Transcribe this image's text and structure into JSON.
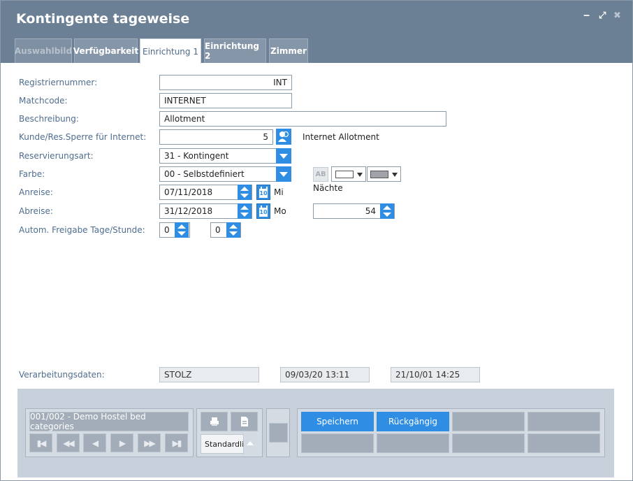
{
  "window": {
    "title": "Kontingente tageweise",
    "controls": {
      "minimize": "‒",
      "restore": "⤢",
      "close": "✖"
    }
  },
  "tabs": [
    {
      "label": "Auswahlbild",
      "state": "disabled"
    },
    {
      "label": "Verfügbarkeit",
      "state": "normal"
    },
    {
      "label": "Einrichtung 1",
      "state": "active"
    },
    {
      "label": "Einrichtung 2",
      "state": "normal"
    },
    {
      "label": "Zimmer",
      "state": "normal"
    }
  ],
  "form": {
    "registriernummer": {
      "label": "Registriernummer:",
      "value": "INT"
    },
    "matchcode": {
      "label": "Matchcode:",
      "value": "INTERNET"
    },
    "beschreibung": {
      "label": "Beschreibung:",
      "value": "Allotment"
    },
    "kunde": {
      "label": "Kunde/Res.Sperre für Internet:",
      "value": "5",
      "name": "Internet Allotment"
    },
    "reservierungsart": {
      "label": "Reservierungsart:",
      "value": "31 - Kontingent"
    },
    "farbe": {
      "label": "Farbe:",
      "value": "00 - Selbstdefiniert",
      "ab_label": "AB",
      "naechte_label": "Nächte"
    },
    "anreise": {
      "label": "Anreise:",
      "value": "07/11/2018",
      "weekday": "Mi"
    },
    "abreise": {
      "label": "Abreise:",
      "value": "31/12/2018",
      "weekday": "Mo",
      "naechte": "54"
    },
    "freigabe": {
      "label": "Autom. Freigabe Tage/Stunde:",
      "tage": "0",
      "stunde": "0"
    },
    "cal_day": "10"
  },
  "processing": {
    "label": "Verarbeitungsdaten:",
    "user": "STOLZ",
    "date1": "09/03/20 13:11",
    "date2": "21/10/01 14:25"
  },
  "toolbar": {
    "record": "001/002 - Demo Hostel bed categories",
    "nav": {
      "first": "▮◀",
      "prev_fast": "◀◀",
      "prev": "◀",
      "next": "▶",
      "next_fast": "▶▶",
      "last": "▶▮"
    },
    "print_select": "Standardli",
    "save": "Speichern",
    "undo": "Rückgängig"
  },
  "colors": {
    "titlebar": "#6b7f95",
    "accent": "#2f8de4",
    "label": "#4f6d8e"
  }
}
